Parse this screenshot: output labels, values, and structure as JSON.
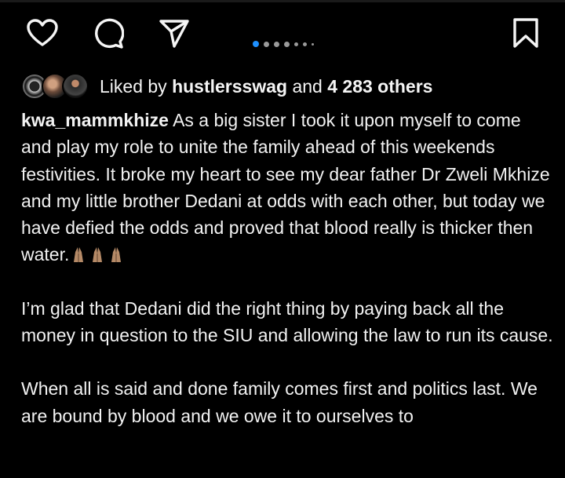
{
  "actions": {
    "like_icon": "heart-outline",
    "comment_icon": "speech-bubble",
    "share_icon": "paper-plane",
    "save_icon": "bookmark-outline",
    "carousel_indicator_color": "#1e90ff"
  },
  "likes": {
    "prefix": "Liked by",
    "user": "hustlersswag",
    "middle": "and",
    "count": "4 283 others"
  },
  "caption": {
    "username": "kwa_mammkhize",
    "para1": "As a big sister I took it upon myself to come and play my role to unite the family ahead of this weekends festivities.  It broke my heart to see my dear father Dr Zweli Mkhize and my little brother Dedani at odds with each other, but today we have defied the odds and proved that blood really is thicker then water.",
    "emoji": "folded-hands x3",
    "para2": "I’m glad that Dedani did the right thing by paying back all the money in question to the SIU and allowing the law to run its cause.",
    "para3": "When all is said and done family comes first and politics last. We are bound by blood and we owe it to ourselves to"
  }
}
